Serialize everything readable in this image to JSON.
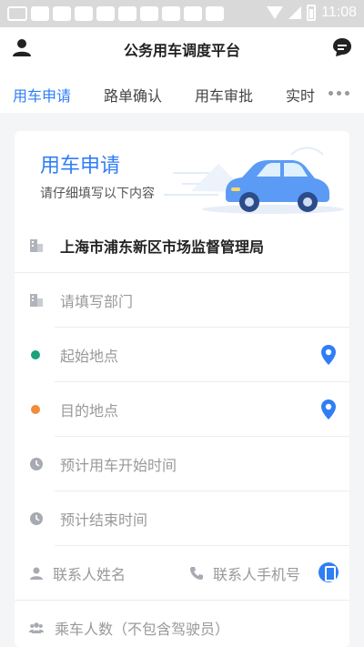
{
  "status_bar": {
    "time": "11:08"
  },
  "header": {
    "title": "公务用车调度平台"
  },
  "tabs": [
    {
      "label": "用车申请",
      "active": true
    },
    {
      "label": "路单确认",
      "active": false
    },
    {
      "label": "用车审批",
      "active": false
    },
    {
      "label": "实时",
      "active": false
    }
  ],
  "banner": {
    "title": "用车申请",
    "subtitle": "请仔细填写以下内容"
  },
  "form": {
    "organization": "上海市浦东新区市场监督管理局",
    "department_placeholder": "请填写部门",
    "start_location_placeholder": "起始地点",
    "destination_placeholder": "目的地点",
    "start_time_placeholder": "预计用车开始时间",
    "end_time_placeholder": "预计结束时间",
    "contact_name_placeholder": "联系人姓名",
    "contact_phone_placeholder": "联系人手机号",
    "passengers_placeholder": "乘车人数（不包含驾驶员）"
  },
  "colors": {
    "accent": "#2f7ef6",
    "start_dot": "#1aa37a",
    "end_dot": "#f08c3a",
    "background": "#f4f5f7"
  }
}
